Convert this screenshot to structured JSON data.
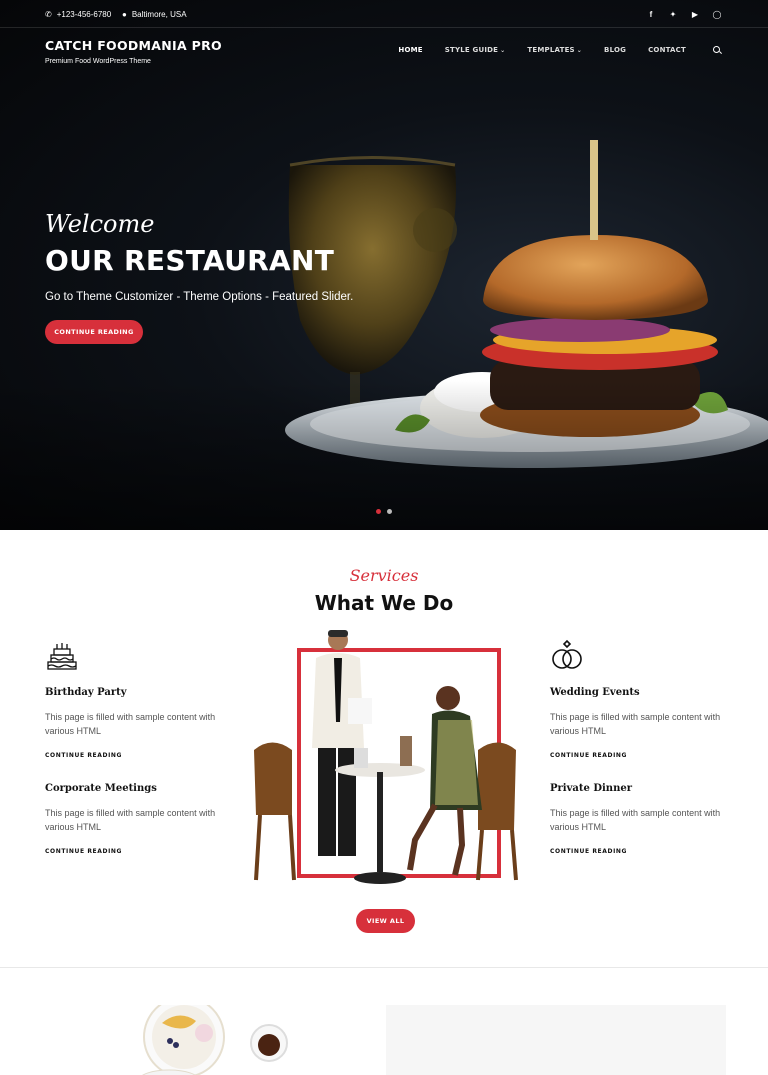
{
  "topbar": {
    "phone": "+123-456-6780",
    "location": "Baltimore, USA",
    "socials": [
      "facebook-icon",
      "twitter-icon",
      "youtube-icon",
      "instagram-icon"
    ]
  },
  "site": {
    "title": "CATCH FOODMANIA PRO",
    "tagline": "Premium Food WordPress Theme"
  },
  "nav": {
    "items": [
      {
        "label": "HOME",
        "active": true
      },
      {
        "label": "STYLE GUIDE",
        "dropdown": true
      },
      {
        "label": "TEMPLATES",
        "dropdown": true
      },
      {
        "label": "BLOG"
      },
      {
        "label": "CONTACT"
      }
    ]
  },
  "hero": {
    "kicker": "Welcome",
    "title": "OUR RESTAURANT",
    "subtitle": "Go to Theme Customizer - Theme Options - Featured Slider.",
    "button": "CONTINUE READING",
    "slides": 2,
    "active_slide": 1
  },
  "services": {
    "kicker": "Services",
    "title": "What We Do",
    "items": [
      {
        "name": "Birthday Party",
        "desc": "This page is filled with sample content with various HTML",
        "link": "CONTINUE READING",
        "icon": "cake-icon"
      },
      {
        "name": "Corporate Meetings",
        "desc": "This page is filled with sample content with various HTML",
        "link": "CONTINUE READING"
      },
      {
        "name": "Wedding Events",
        "desc": "This page is filled with sample content with various HTML",
        "link": "CONTINUE READING",
        "icon": "rings-icon"
      },
      {
        "name": "Private Dinner",
        "desc": "This page is filled with sample content with various HTML",
        "link": "CONTINUE READING"
      }
    ],
    "button": "VIEW ALL"
  },
  "colors": {
    "accent": "#d7303b",
    "dark": "#111111"
  }
}
